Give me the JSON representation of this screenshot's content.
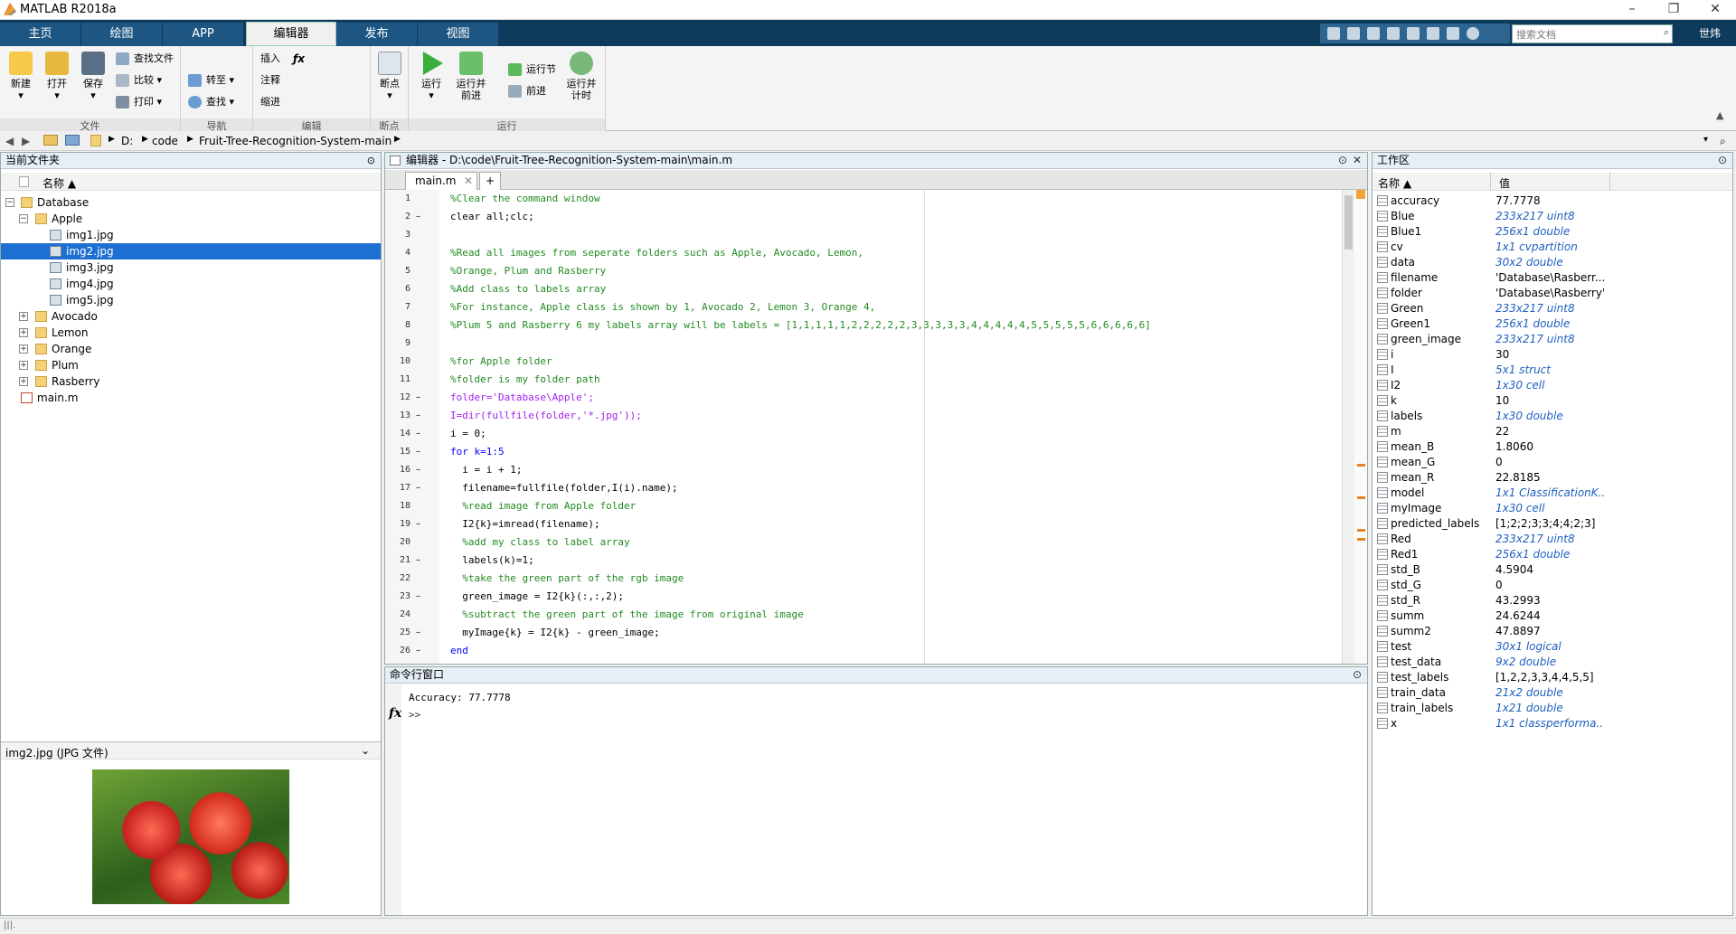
{
  "window": {
    "title": "MATLAB R2018a"
  },
  "tabs": [
    {
      "label": "主页"
    },
    {
      "label": "绘图"
    },
    {
      "label": "APP"
    },
    {
      "label": "编辑器"
    },
    {
      "label": "发布"
    },
    {
      "label": "视图"
    }
  ],
  "search": {
    "placeholder": "搜索文档"
  },
  "user": {
    "label": "世炜"
  },
  "ribbon": {
    "new": "新建",
    "open": "打开",
    "save": "保存",
    "findfiles": "查找文件",
    "compare": "比较",
    "print": "打印",
    "goto": "转至",
    "find": "查找",
    "insert": "插入",
    "comment": "注释",
    "indent": "缩进",
    "breakpoints": "断点",
    "run": "运行",
    "run_advance": "运行并\n前进",
    "run_section": "运行节",
    "advance": "前进",
    "run_time": "运行并\n计时",
    "groups": {
      "file": "文件",
      "nav": "导航",
      "edit": "编辑",
      "bp": "断点",
      "run": "运行"
    }
  },
  "address": {
    "parts": [
      "D:",
      "code",
      "Fruit-Tree-Recognition-System-main"
    ]
  },
  "current_folder": {
    "title": "当前文件夹",
    "col_name": "名称 ▲",
    "items": [
      {
        "label": "Database"
      },
      {
        "label": "Apple"
      },
      {
        "label": "img1.jpg"
      },
      {
        "label": "img2.jpg"
      },
      {
        "label": "img3.jpg"
      },
      {
        "label": "img4.jpg"
      },
      {
        "label": "img5.jpg"
      },
      {
        "label": "Avocado"
      },
      {
        "label": "Lemon"
      },
      {
        "label": "Orange"
      },
      {
        "label": "Plum"
      },
      {
        "label": "Rasberry"
      },
      {
        "label": "main.m"
      }
    ],
    "preview_label": "img2.jpg  (JPG 文件)"
  },
  "editor": {
    "title": "编辑器 - D:\\code\\Fruit-Tree-Recognition-System-main\\main.m",
    "tab": "main.m",
    "lines": [
      {
        "n": "1",
        "d": "",
        "t": "%Clear the command window"
      },
      {
        "n": "2",
        "d": "–",
        "t": "clear all;clc;"
      },
      {
        "n": "3",
        "d": "",
        "t": ""
      },
      {
        "n": "4",
        "d": "",
        "t": "%Read all images from seperate folders such as Apple, Avocado, Lemon,"
      },
      {
        "n": "5",
        "d": "",
        "t": "%Orange, Plum and Rasberry"
      },
      {
        "n": "6",
        "d": "",
        "t": "%Add class to labels array"
      },
      {
        "n": "7",
        "d": "",
        "t": "%For instance, Apple class is shown by 1, Avocado 2, Lemon 3, Orange 4,"
      },
      {
        "n": "8",
        "d": "",
        "t": "%Plum 5 and Rasberry 6 my labels array will be labels = [1,1,1,1,1,2,2,2,2,2,3,3,3,3,3,4,4,4,4,4,5,5,5,5,5,6,6,6,6,6]"
      },
      {
        "n": "9",
        "d": "",
        "t": ""
      },
      {
        "n": "10",
        "d": "",
        "t": "%for Apple folder"
      },
      {
        "n": "11",
        "d": "",
        "t": "%folder is my folder path"
      },
      {
        "n": "12",
        "d": "–",
        "t": "folder='Database\\Apple';"
      },
      {
        "n": "13",
        "d": "–",
        "t": "I=dir(fullfile(folder,'*.jpg'));"
      },
      {
        "n": "14",
        "d": "–",
        "t": "i = 0;"
      },
      {
        "n": "15",
        "d": "–",
        "t": "for k=1:5"
      },
      {
        "n": "16",
        "d": "–",
        "t": "  i = i + 1;"
      },
      {
        "n": "17",
        "d": "–",
        "t": "  filename=fullfile(folder,I(i).name);"
      },
      {
        "n": "18",
        "d": "",
        "t": "  %read image from Apple folder"
      },
      {
        "n": "19",
        "d": "–",
        "t": "  I2{k}=imread(filename);"
      },
      {
        "n": "20",
        "d": "",
        "t": "  %add my class to label array"
      },
      {
        "n": "21",
        "d": "–",
        "t": "  labels(k)=1;"
      },
      {
        "n": "22",
        "d": "",
        "t": "  %take the green part of the rgb image"
      },
      {
        "n": "23",
        "d": "–",
        "t": "  green_image = I2{k}(:,:,2);"
      },
      {
        "n": "24",
        "d": "",
        "t": "  %subtract the green part of the image from original image"
      },
      {
        "n": "25",
        "d": "–",
        "t": "  myImage{k} = I2{k} - green_image;"
      },
      {
        "n": "26",
        "d": "–",
        "t": "end"
      }
    ]
  },
  "command": {
    "title": "命令行窗口",
    "output": "Accuracy: 77.7778",
    "prompt": ">>",
    "fx": "fx"
  },
  "workspace": {
    "title": "工作区",
    "col_name": "名称 ▲",
    "col_value": "值",
    "vars": [
      {
        "name": "accuracy",
        "value": "77.7778",
        "it": false
      },
      {
        "name": "Blue",
        "value": "233x217 uint8",
        "it": true
      },
      {
        "name": "Blue1",
        "value": "256x1 double",
        "it": true
      },
      {
        "name": "cv",
        "value": "1x1 cvpartition",
        "it": true
      },
      {
        "name": "data",
        "value": "30x2 double",
        "it": true
      },
      {
        "name": "filename",
        "value": "'Database\\Rasberr...",
        "it": false
      },
      {
        "name": "folder",
        "value": "'Database\\Rasberry'",
        "it": false
      },
      {
        "name": "Green",
        "value": "233x217 uint8",
        "it": true
      },
      {
        "name": "Green1",
        "value": "256x1 double",
        "it": true
      },
      {
        "name": "green_image",
        "value": "233x217 uint8",
        "it": true
      },
      {
        "name": "i",
        "value": "30",
        "it": false
      },
      {
        "name": "I",
        "value": "5x1 struct",
        "it": true
      },
      {
        "name": "I2",
        "value": "1x30 cell",
        "it": true
      },
      {
        "name": "k",
        "value": "10",
        "it": false
      },
      {
        "name": "labels",
        "value": "1x30 double",
        "it": true
      },
      {
        "name": "m",
        "value": "22",
        "it": false
      },
      {
        "name": "mean_B",
        "value": "1.8060",
        "it": false
      },
      {
        "name": "mean_G",
        "value": "0",
        "it": false
      },
      {
        "name": "mean_R",
        "value": "22.8185",
        "it": false
      },
      {
        "name": "model",
        "value": "1x1 ClassificationK...",
        "it": true
      },
      {
        "name": "myImage",
        "value": "1x30 cell",
        "it": true
      },
      {
        "name": "predicted_labels",
        "value": "[1;2;2;3;3;4;4;2;3]",
        "it": false
      },
      {
        "name": "Red",
        "value": "233x217 uint8",
        "it": true
      },
      {
        "name": "Red1",
        "value": "256x1 double",
        "it": true
      },
      {
        "name": "std_B",
        "value": "4.5904",
        "it": false
      },
      {
        "name": "std_G",
        "value": "0",
        "it": false
      },
      {
        "name": "std_R",
        "value": "43.2993",
        "it": false
      },
      {
        "name": "summ",
        "value": "24.6244",
        "it": false
      },
      {
        "name": "summ2",
        "value": "47.8897",
        "it": false
      },
      {
        "name": "test",
        "value": "30x1 logical",
        "it": true
      },
      {
        "name": "test_data",
        "value": "9x2 double",
        "it": true
      },
      {
        "name": "test_labels",
        "value": "[1,2,2,3,3,4,4,5,5]",
        "it": false
      },
      {
        "name": "train_data",
        "value": "21x2 double",
        "it": true
      },
      {
        "name": "train_labels",
        "value": "1x21 double",
        "it": true
      },
      {
        "name": "x",
        "value": "1x1 classperforma...",
        "it": true
      }
    ]
  }
}
